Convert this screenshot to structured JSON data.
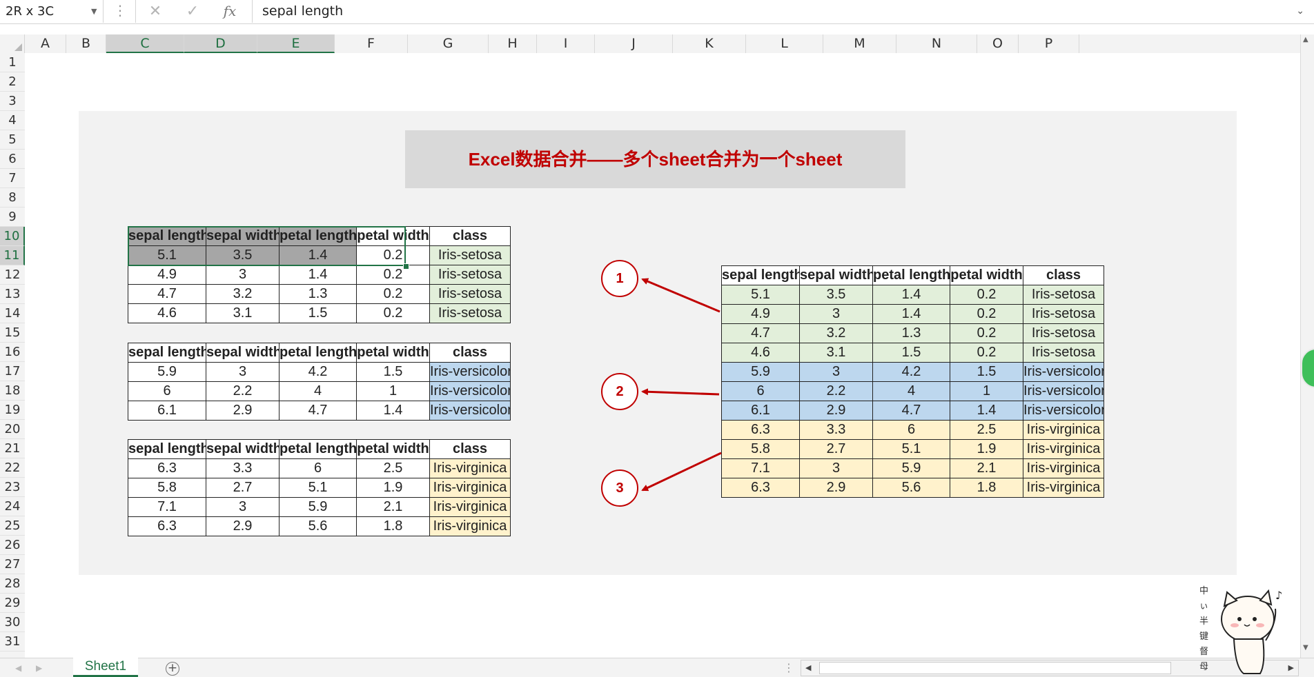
{
  "formula_bar": {
    "name_box": "2R x 3C",
    "formula": "sepal length",
    "cancel_icon": "✕",
    "enter_icon": "✓",
    "fx_label": "fx"
  },
  "columns": [
    "A",
    "B",
    "C",
    "D",
    "E",
    "F",
    "G",
    "H",
    "I",
    "J",
    "K",
    "L",
    "M",
    "N",
    "O",
    "P"
  ],
  "rows": [
    "1",
    "2",
    "3",
    "4",
    "5",
    "6",
    "7",
    "8",
    "9",
    "10",
    "11",
    "12",
    "13",
    "14",
    "15",
    "16",
    "17",
    "18",
    "19",
    "20",
    "21",
    "22",
    "23",
    "24",
    "25",
    "26",
    "27",
    "28",
    "29",
    "30",
    "31"
  ],
  "title": "Excel数据合并——多个sheet合并为一个sheet",
  "headers": [
    "sepal length",
    "sepal width",
    "petal length",
    "petal width",
    "class"
  ],
  "table1": [
    [
      "5.1",
      "3.5",
      "1.4",
      "0.2",
      "Iris-setosa"
    ],
    [
      "4.9",
      "3",
      "1.4",
      "0.2",
      "Iris-setosa"
    ],
    [
      "4.7",
      "3.2",
      "1.3",
      "0.2",
      "Iris-setosa"
    ],
    [
      "4.6",
      "3.1",
      "1.5",
      "0.2",
      "Iris-setosa"
    ]
  ],
  "table2": [
    [
      "5.9",
      "3",
      "4.2",
      "1.5",
      "Iris-versicolor"
    ],
    [
      "6",
      "2.2",
      "4",
      "1",
      "Iris-versicolor"
    ],
    [
      "6.1",
      "2.9",
      "4.7",
      "1.4",
      "Iris-versicolor"
    ]
  ],
  "table3": [
    [
      "6.3",
      "3.3",
      "6",
      "2.5",
      "Iris-virginica"
    ],
    [
      "5.8",
      "2.7",
      "5.1",
      "1.9",
      "Iris-virginica"
    ],
    [
      "7.1",
      "3",
      "5.9",
      "2.1",
      "Iris-virginica"
    ],
    [
      "6.3",
      "2.9",
      "5.6",
      "1.8",
      "Iris-virginica"
    ]
  ],
  "merged": [
    [
      "5.1",
      "3.5",
      "1.4",
      "0.2",
      "Iris-setosa"
    ],
    [
      "4.9",
      "3",
      "1.4",
      "0.2",
      "Iris-setosa"
    ],
    [
      "4.7",
      "3.2",
      "1.3",
      "0.2",
      "Iris-setosa"
    ],
    [
      "4.6",
      "3.1",
      "1.5",
      "0.2",
      "Iris-setosa"
    ],
    [
      "5.9",
      "3",
      "4.2",
      "1.5",
      "Iris-versicolor"
    ],
    [
      "6",
      "2.2",
      "4",
      "1",
      "Iris-versicolor"
    ],
    [
      "6.1",
      "2.9",
      "4.7",
      "1.4",
      "Iris-versicolor"
    ],
    [
      "6.3",
      "3.3",
      "6",
      "2.5",
      "Iris-virginica"
    ],
    [
      "5.8",
      "2.7",
      "5.1",
      "1.9",
      "Iris-virginica"
    ],
    [
      "7.1",
      "3",
      "5.9",
      "2.1",
      "Iris-virginica"
    ],
    [
      "6.3",
      "2.9",
      "5.6",
      "1.8",
      "Iris-virginica"
    ]
  ],
  "callouts": [
    "1",
    "2",
    "3"
  ],
  "sheet_tab": "Sheet1",
  "add_sheet_icon": "+",
  "colors": {
    "title_red": "#c00000",
    "setosa": "#e2efda",
    "versicolor": "#bdd7ee",
    "virginica": "#fff2cc",
    "excel_green": "#217346",
    "selected_cell": "#a6a6a6"
  },
  "mascot_text": "中 ぃ 半 键 督 母"
}
